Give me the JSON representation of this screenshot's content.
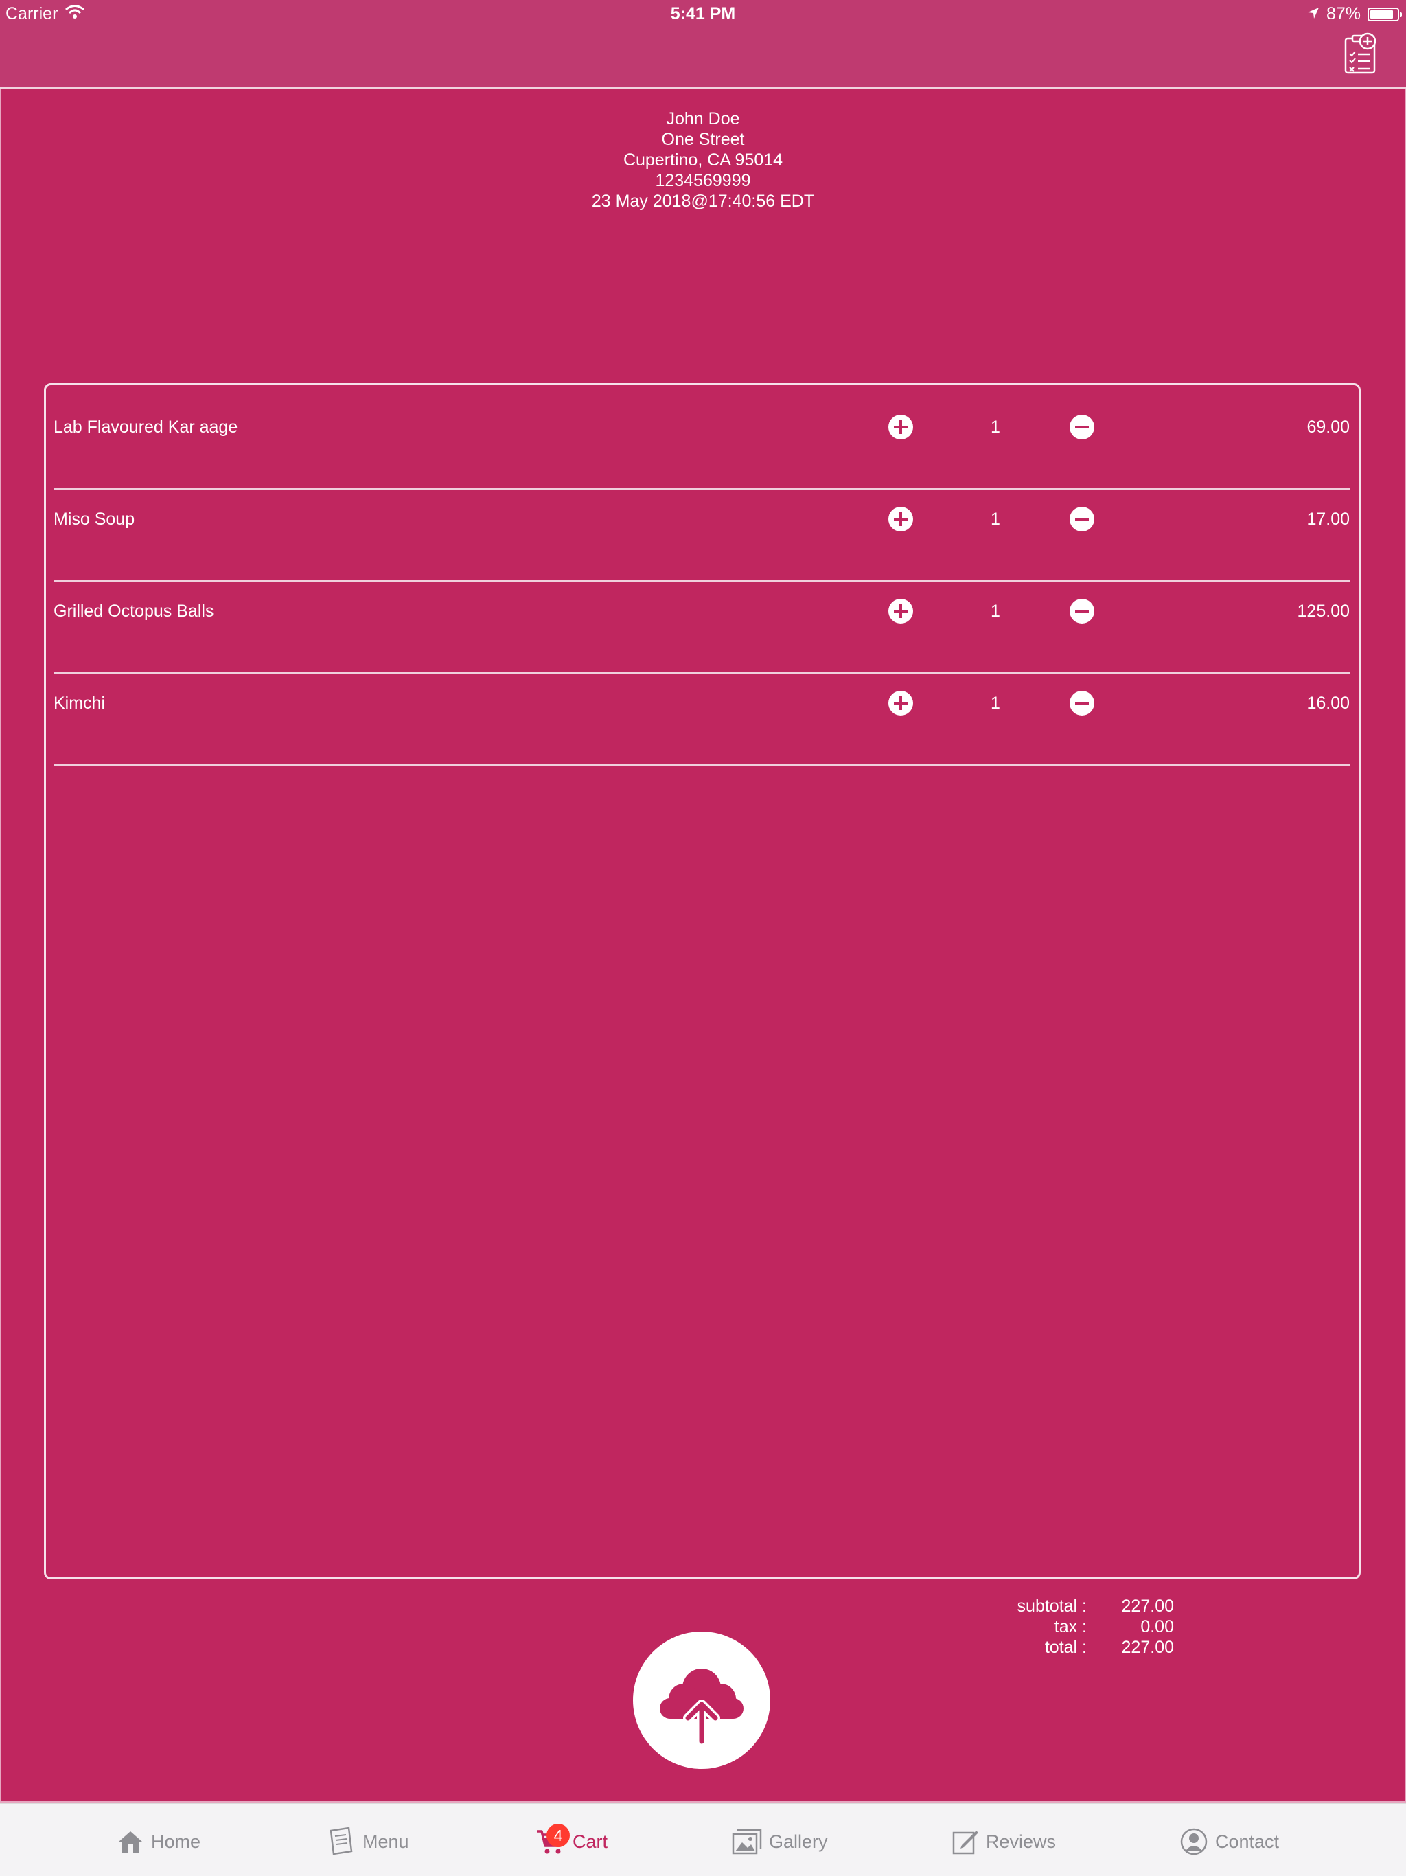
{
  "status_bar": {
    "carrier": "Carrier",
    "time": "5:41 PM",
    "battery_text": "87%",
    "battery_level": 0.87
  },
  "nav": {
    "right_icon": "clipboard-checklist-add-icon"
  },
  "customer": {
    "name": "John Doe",
    "street": "One Street",
    "city_line": "Cupertino, CA 95014",
    "phone": "1234569999",
    "datetime": "23 May 2018@17:40:56 EDT"
  },
  "order_items": [
    {
      "name": "Lab Flavoured Kar aage",
      "qty": "1",
      "price": "69.00"
    },
    {
      "name": "Miso Soup",
      "qty": "1",
      "price": "17.00"
    },
    {
      "name": "Grilled Octopus Balls",
      "qty": "1",
      "price": "125.00"
    },
    {
      "name": "Kimchi",
      "qty": "1",
      "price": "16.00"
    }
  ],
  "totals": {
    "subtotal_label": "subtotal :",
    "subtotal": "227.00",
    "tax_label": "tax :",
    "tax": "0.00",
    "total_label": "total :",
    "total": "227.00"
  },
  "upload_icon": "cloud-upload-icon",
  "tabbar": {
    "tabs": [
      {
        "label": "Home",
        "icon": "home-icon"
      },
      {
        "label": "Menu",
        "icon": "menu-icon"
      },
      {
        "label": "Cart",
        "icon": "cart-icon",
        "badge": "4",
        "active": true
      },
      {
        "label": "Gallery",
        "icon": "gallery-icon"
      },
      {
        "label": "Reviews",
        "icon": "reviews-icon"
      },
      {
        "label": "Contact",
        "icon": "contact-icon"
      }
    ]
  },
  "colors": {
    "background": "#c0265f",
    "navbar": "#bf3a70",
    "tabbar": "#f4f3f5",
    "active_tab": "#c0265f",
    "badge": "#ff3b30"
  }
}
